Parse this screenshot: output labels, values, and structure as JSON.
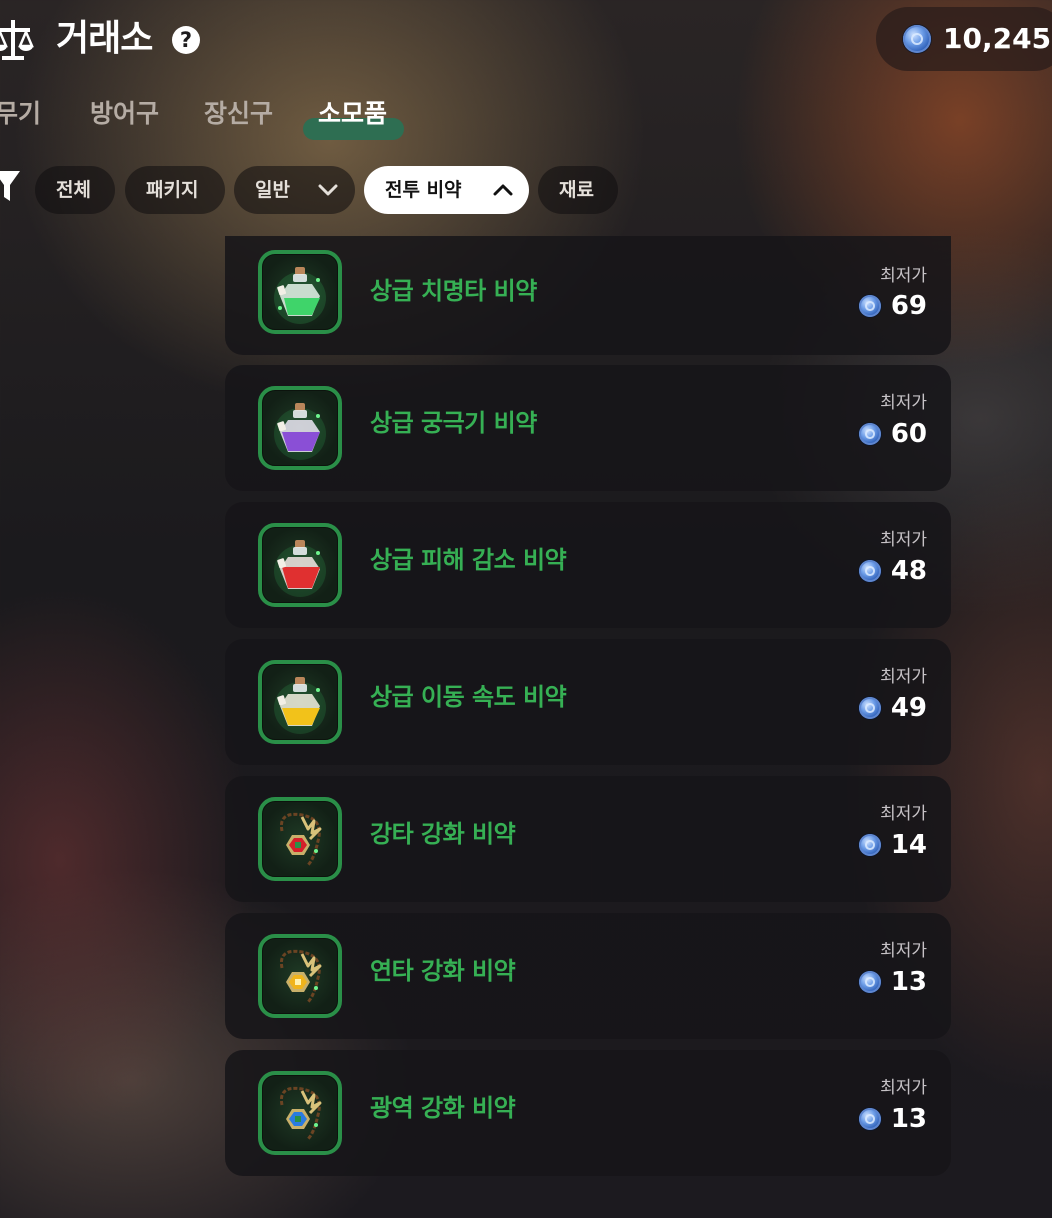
{
  "header": {
    "title": "거래소",
    "help_icon": "?",
    "currency_icon": "blue-coin-icon",
    "currency_amount": "10,245"
  },
  "tabs": [
    {
      "label": "무기",
      "active": false
    },
    {
      "label": "방어구",
      "active": false
    },
    {
      "label": "장신구",
      "active": false
    },
    {
      "label": "소모품",
      "active": true
    }
  ],
  "filters": {
    "icon": "filter-icon",
    "chips": [
      {
        "label": "전체",
        "active": false
      },
      {
        "label": "패키지",
        "active": false
      },
      {
        "label": "일반",
        "active": false,
        "chevron": "down"
      },
      {
        "label": "전투 비약",
        "active": true,
        "chevron": "up"
      },
      {
        "label": "재료",
        "active": false
      }
    ]
  },
  "items": [
    {
      "name": "상급 치명타 비약",
      "price_label": "최저가",
      "price": "69",
      "icon": "green-potion-icon",
      "color": "#3fd46a"
    },
    {
      "name": "상급 궁극기 비약",
      "price_label": "최저가",
      "price": "60",
      "icon": "purple-potion-icon",
      "color": "#8a4fd6"
    },
    {
      "name": "상급 피해 감소 비약",
      "price_label": "최저가",
      "price": "48",
      "icon": "red-potion-icon",
      "color": "#e03030"
    },
    {
      "name": "상급 이동 속도 비약",
      "price_label": "최저가",
      "price": "49",
      "icon": "yellow-potion-icon",
      "color": "#f2c21a"
    },
    {
      "name": "강타 강화 비약",
      "price_label": "최저가",
      "price": "14",
      "icon": "red-gem-charm-icon",
      "color": "#d4202a"
    },
    {
      "name": "연타 강화 비약",
      "price_label": "최저가",
      "price": "13",
      "icon": "yellow-gem-charm-icon",
      "color": "#f0b41c"
    },
    {
      "name": "광역 강화 비약",
      "price_label": "최저가",
      "price": "13",
      "icon": "blue-gem-charm-icon",
      "color": "#2a7be0"
    }
  ],
  "colors": {
    "accent_green": "#36b054",
    "tab_underline": "#2e6e52",
    "icon_border": "#2a8f48"
  }
}
